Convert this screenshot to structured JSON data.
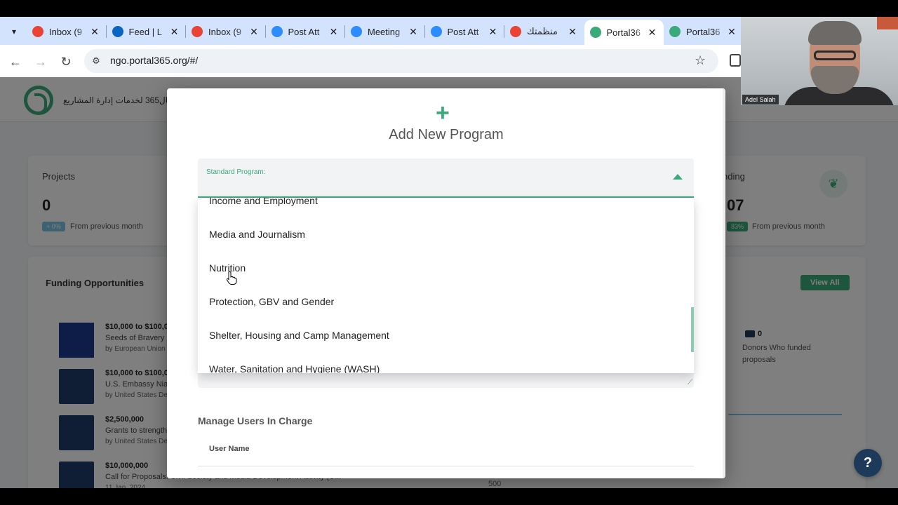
{
  "browser": {
    "tabs": [
      {
        "title": "Inbox (9",
        "icon": "gmail-icon",
        "color": "#ea4335"
      },
      {
        "title": "Feed | L",
        "icon": "linkedin-icon",
        "color": "#0a66c2"
      },
      {
        "title": "Inbox (9",
        "icon": "gmail-icon",
        "color": "#ea4335"
      },
      {
        "title": "Post Att",
        "icon": "zoom-icon",
        "color": "#2d8cff"
      },
      {
        "title": "Meeting",
        "icon": "zoom-icon",
        "color": "#2d8cff"
      },
      {
        "title": "Post Att",
        "icon": "zoom-icon",
        "color": "#2d8cff"
      },
      {
        "title": "منظمتك",
        "icon": "gmail-icon",
        "color": "#ea4335"
      },
      {
        "title": "Portal36",
        "icon": "portal-icon",
        "color": "#3aaa7a",
        "active": true
      },
      {
        "title": "Portal36",
        "icon": "portal-icon",
        "color": "#3aaa7a"
      }
    ],
    "url": "ngo.portal365.org/#/"
  },
  "webcam": {
    "name": "Adel Salah"
  },
  "app": {
    "brand": "بورتال365 لخدمات إدارة المشاريع",
    "cards": {
      "projects": {
        "label": "Projects",
        "value": "0",
        "chip": "+ 0%",
        "sub": "From previous month"
      },
      "funding": {
        "label": "nding",
        "value": "07",
        "chip": "83%",
        "sub": "From previous month"
      }
    },
    "funding_opps": {
      "title": "Funding Opportunities",
      "view_all": "View All",
      "items": [
        {
          "amount": "$10,000 to $100,0",
          "name": "Seeds of Bravery",
          "by": "by European Union"
        },
        {
          "amount": "$10,000 to $100,0",
          "name": "U.S. Embassy Nia",
          "by": "by United States De"
        },
        {
          "amount": "$2,500,000",
          "name": "Grants to strength",
          "by": "by United States De"
        },
        {
          "amount": "$10,000,000",
          "name": "Call for Proposals: Civil Society and Media Development Activity (U...",
          "by": "11 Jan, 2024"
        }
      ]
    },
    "donors": {
      "count": "0",
      "label": "Donors Who funded proposals"
    },
    "axis_tick": "500"
  },
  "modal": {
    "plus": "+",
    "title": "Add New Program",
    "select_label": "Standard Program:",
    "options": [
      "Income and Employment",
      "Media and Journalism",
      "Nutrition",
      "Protection, GBV and Gender",
      "Shelter, Housing and Camp Management",
      "Water, Sanitation and Hygiene (WASH)"
    ],
    "users_title": "Manage Users In Charge",
    "users_col": "User Name"
  },
  "help": "?",
  "colors": {
    "accent": "#3aaa7a",
    "tabstrip": "#d3e3fd"
  }
}
